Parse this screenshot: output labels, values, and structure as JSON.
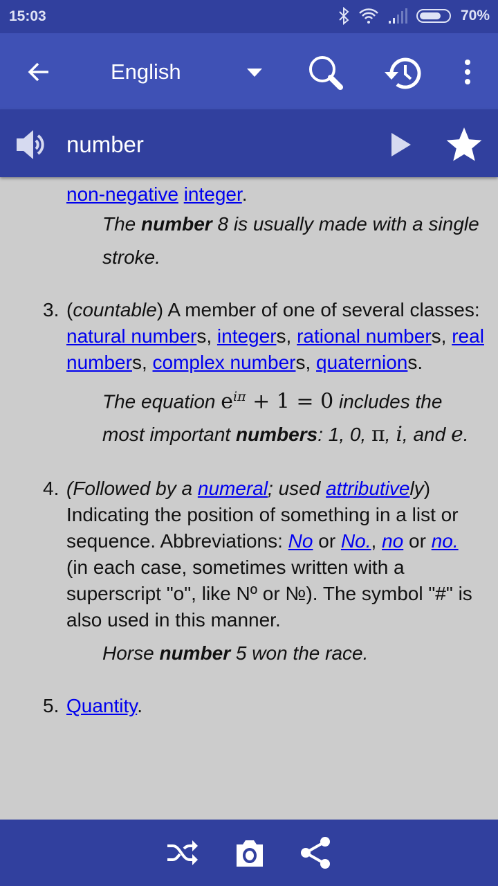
{
  "status_bar": {
    "time": "15:03",
    "battery": "70%"
  },
  "toolbar": {
    "language": "English",
    "icons": [
      "back-arrow-icon",
      "dropdown-icon",
      "search-icon",
      "history-icon",
      "more-vert-icon"
    ]
  },
  "word_bar": {
    "word": "number",
    "icons": [
      "speaker-icon",
      "play-icon",
      "star-icon"
    ]
  },
  "colors": {
    "primary": "#3f51b5",
    "primary_dark": "#31409e",
    "background": "#cccccc",
    "link": "#0000ee"
  },
  "content": [
    {
      "type": "def",
      "num": "",
      "segs": [
        {
          "t": "non-negative",
          "a": 1
        },
        {
          "t": " "
        },
        {
          "t": "integer",
          "a": 1
        },
        {
          "t": "."
        }
      ],
      "mt": 6
    },
    {
      "type": "ex",
      "segs": [
        {
          "t": "The "
        },
        {
          "t": "number",
          "b": 1
        },
        {
          "t": " 8 is usually made with a single stroke."
        }
      ],
      "mt": 0
    },
    {
      "type": "def",
      "num": "3.",
      "segs": [
        {
          "t": "("
        },
        {
          "t": "countable",
          "i": 1
        },
        {
          "t": ") A member of one of several classes: "
        },
        {
          "t": "natural number",
          "a": 1
        },
        {
          "t": "s, "
        },
        {
          "t": "integer",
          "a": 1
        },
        {
          "t": "s, "
        },
        {
          "t": "rational number",
          "a": 1
        },
        {
          "t": "s, "
        },
        {
          "t": "real number",
          "a": 1
        },
        {
          "t": "s, "
        },
        {
          "t": "complex number",
          "a": 1
        },
        {
          "t": "s, "
        },
        {
          "t": "quaternion",
          "a": 1
        },
        {
          "t": "s."
        }
      ],
      "mt": 33
    },
    {
      "type": "ex",
      "segs": [
        {
          "t": "The equation "
        },
        {
          "t": "e",
          "m": 1
        },
        {
          "t": "iπ",
          "sup": 1
        },
        {
          "t": " + 1 = 0",
          "m": 1
        },
        {
          "t": " includes the most important "
        },
        {
          "t": "numbers",
          "b": 1
        },
        {
          "t": ": 1, 0, "
        },
        {
          "t": "π",
          "m": 1
        },
        {
          "t": ", "
        },
        {
          "t": "i",
          "mi": 1
        },
        {
          "t": ", and "
        },
        {
          "t": "e",
          "mi": 1
        },
        {
          "t": "."
        }
      ],
      "mt": 6
    },
    {
      "type": "def",
      "num": "4.",
      "segs": [
        {
          "t": "(Followed by a ",
          "i": 1
        },
        {
          "t": "numeral",
          "a": 1,
          "i": 1
        },
        {
          "t": "; used ",
          "i": 1
        },
        {
          "t": "attributive",
          "a": 1,
          "i": 1
        },
        {
          "t": "ly",
          "i": 1
        },
        {
          "t": ") Indicating the position of something in a list or sequence. Abbreviations: "
        },
        {
          "t": "No",
          "a": 1,
          "i": 1
        },
        {
          "t": " or "
        },
        {
          "t": "No.",
          "a": 1,
          "i": 1
        },
        {
          "t": ", "
        },
        {
          "t": "no",
          "a": 1,
          "i": 1
        },
        {
          "t": " or "
        },
        {
          "t": "no.",
          "a": 1,
          "i": 1
        },
        {
          "t": " (in each case, sometimes written with a superscript \"o\", like Nº or №). The symbol \"#\" is also used in this manner."
        }
      ],
      "mt": 35
    },
    {
      "type": "ex",
      "segs": [
        {
          "t": "Horse "
        },
        {
          "t": "number",
          "b": 1
        },
        {
          "t": " 5 won the race."
        }
      ],
      "mt": 5
    },
    {
      "type": "def",
      "num": "5.",
      "segs": [
        {
          "t": "Quantity",
          "a": 1
        },
        {
          "t": "."
        }
      ],
      "mt": 33
    }
  ],
  "bottom_bar": {
    "icons": [
      "shuffle-icon",
      "camera-icon",
      "share-icon"
    ]
  }
}
